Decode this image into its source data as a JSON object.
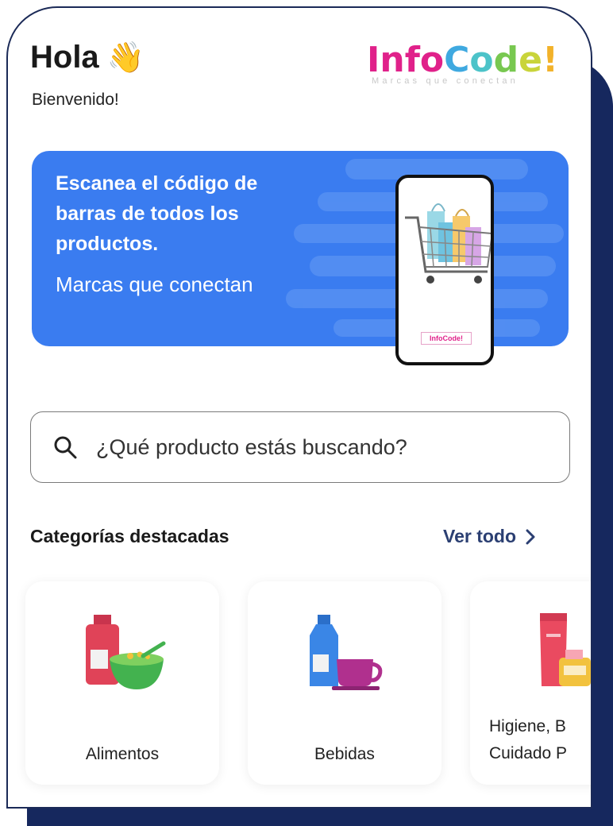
{
  "header": {
    "greeting": "Hola",
    "greeting_emoji": "👋",
    "welcome": "Bienvenido!"
  },
  "logo": {
    "letters": [
      {
        "ch": "I",
        "color": "#e0218a"
      },
      {
        "ch": "n",
        "color": "#e0218a"
      },
      {
        "ch": "f",
        "color": "#e0218a"
      },
      {
        "ch": "o",
        "color": "#e0218a"
      },
      {
        "ch": "C",
        "color": "#3fa9e0"
      },
      {
        "ch": "o",
        "color": "#4cc3c9"
      },
      {
        "ch": "d",
        "color": "#78c850"
      },
      {
        "ch": "e",
        "color": "#c9d43a"
      },
      {
        "ch": "!",
        "color": "#f2b22a"
      }
    ],
    "tagline": "Marcas que conectan"
  },
  "banner": {
    "title": "Escanea el código de barras de todos los productos.",
    "subtitle": "Marcas que conectan",
    "phone_logo": "InfoCode!"
  },
  "search": {
    "placeholder": "¿Qué producto estás buscando?",
    "value": ""
  },
  "categories": {
    "title": "Categorías destacadas",
    "see_all": "Ver todo",
    "items": [
      {
        "label": "Alimentos",
        "icon": "food-bowl-icon"
      },
      {
        "label": "Bebidas",
        "icon": "drink-cup-icon"
      },
      {
        "label": "Higiene, B Cuidado P",
        "icon": "hygiene-bottle-icon"
      }
    ]
  },
  "colors": {
    "brand_navy": "#16285e",
    "banner_blue": "#3a7cf0",
    "link": "#2b3f72"
  }
}
